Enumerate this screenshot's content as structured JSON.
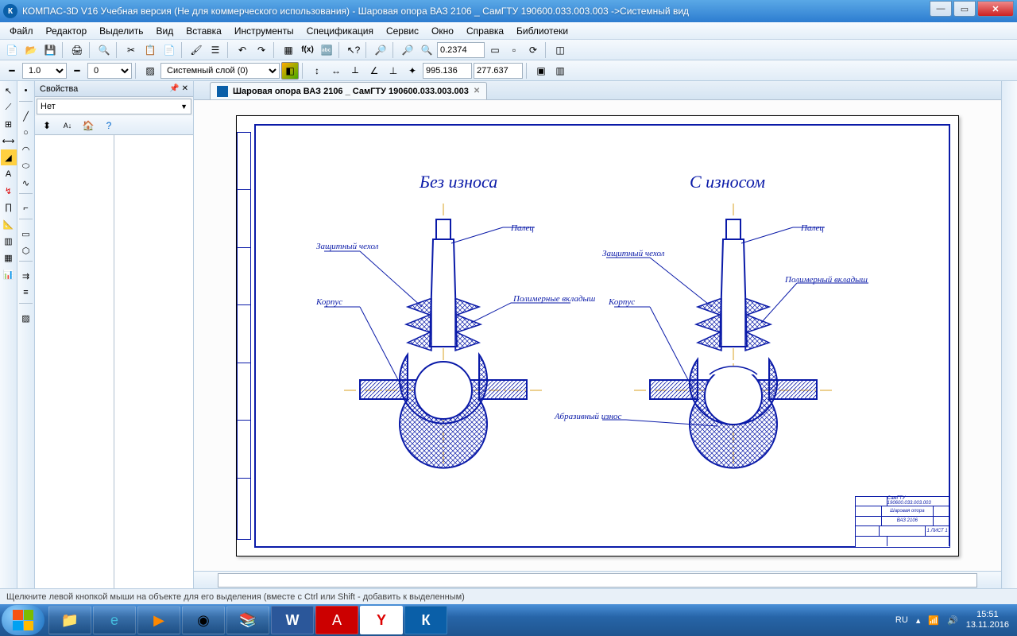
{
  "title": "КОМПАС-3D V16 Учебная версия  (Не для коммерческого использования) - Шаровая опора ВАЗ 2106 _ СамГТУ 190600.033.003.003 ->Системный вид",
  "app_letter": "К",
  "menu": [
    "Файл",
    "Редактор",
    "Выделить",
    "Вид",
    "Вставка",
    "Инструменты",
    "Спецификация",
    "Сервис",
    "Окно",
    "Справка",
    "Библиотеки"
  ],
  "toolbars": {
    "line_style_value": "1.0",
    "line_weight_value": "0",
    "layer_combo": "Системный слой (0)",
    "zoom_value": "0.2374",
    "coord_x": "995.136",
    "coord_y": "277.637"
  },
  "props": {
    "panel_title": "Свойства",
    "combo": "Нет"
  },
  "doc_tab": "Шаровая опора ВАЗ 2106 _ СамГТУ 190600.033.003.003",
  "drawing": {
    "heading_left": "Без износа",
    "heading_right": "С износом",
    "labels": {
      "palec": "Палец",
      "zashitny": "Защитный чехол",
      "korpus": "Корпус",
      "polimer": "Полимерный вкладыш",
      "polimer2": "Полимерные вкладыш",
      "abraziv": "Абразивный износ"
    },
    "title_block": {
      "code": "СамГТУ 190600.033.003.003",
      "name1": "Шаровая опора",
      "name2": "ВАЗ 2106",
      "sheet": "1 ЛИСТ 1"
    }
  },
  "statusbar": "Щелкните левой кнопкой мыши на объекте для его выделения (вместе с Ctrl или Shift - добавить к выделенным)",
  "tray": {
    "lang": "RU",
    "time": "15:51",
    "date": "13.11.2016"
  },
  "right_collapse": ""
}
